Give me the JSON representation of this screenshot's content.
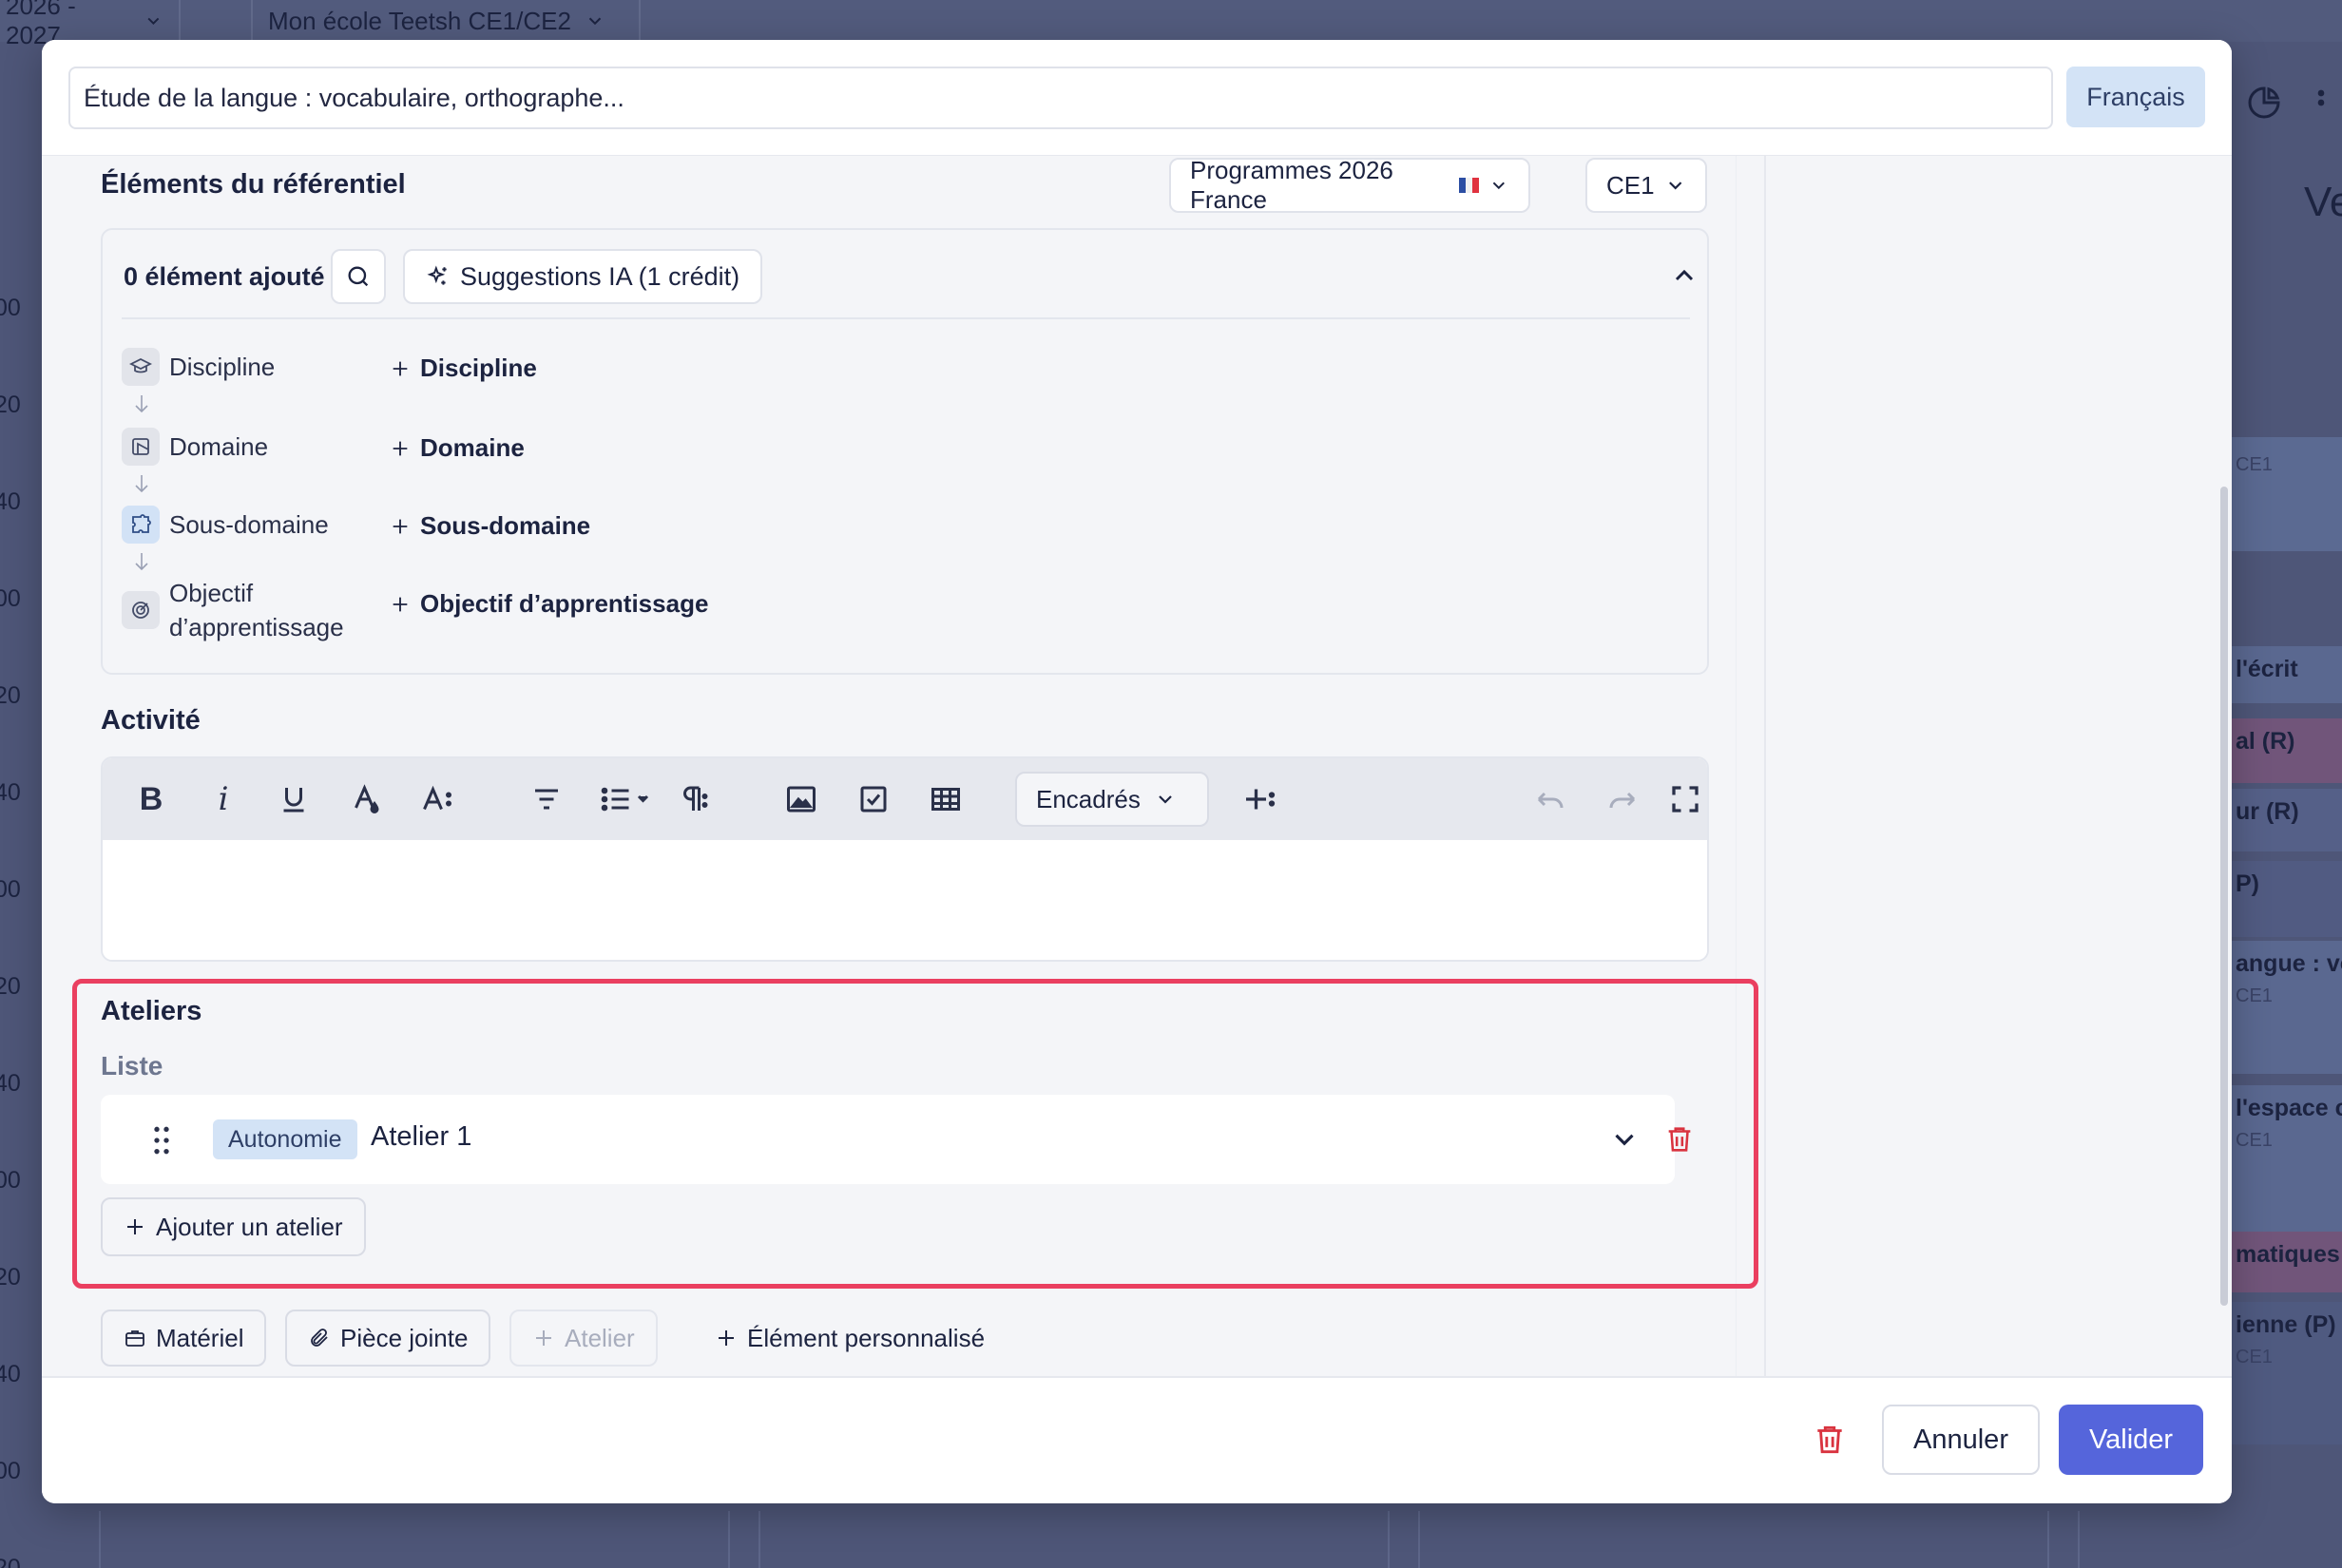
{
  "background": {
    "year_selector": "2026 - 2027",
    "school_selector": "Mon école Teetsh CE1/CE2",
    "hour_labels": [
      "00",
      "20",
      "40",
      "00",
      "20",
      "40",
      "00",
      "20",
      "40",
      "00",
      "20",
      "40",
      "00",
      "20"
    ],
    "heading_fragment": "Ve",
    "events": [
      {
        "title": "",
        "sub": "CE1"
      },
      {
        "title": "l'écrit",
        "sub": ""
      },
      {
        "title": "al (R)",
        "sub": ""
      },
      {
        "title": "ur (R)",
        "sub": ""
      },
      {
        "title": "P)",
        "sub": ""
      },
      {
        "title": "angue : vo",
        "sub": "CE1"
      },
      {
        "title": "l'espace c",
        "sub": "CE1"
      },
      {
        "title": "matiques",
        "sub": ""
      },
      {
        "title": "ienne (P)",
        "sub": "CE1"
      }
    ]
  },
  "header": {
    "title_value": "Étude de la langue : vocabulaire, orthographe...",
    "subject": "Français"
  },
  "referentiel": {
    "title": "Éléments du référentiel",
    "program": "Programmes 2026 France",
    "level": "CE1",
    "count_label": "0 élément ajouté",
    "ai_button": "Suggestions IA (1 crédit)",
    "levels": [
      {
        "icon": "graduation-cap-icon",
        "label": "Discipline",
        "add": "Discipline"
      },
      {
        "icon": "domain-icon",
        "label": "Domaine",
        "add": "Domaine"
      },
      {
        "icon": "puzzle-icon",
        "label": "Sous-domaine",
        "add": "Sous-domaine"
      },
      {
        "icon": "target-icon",
        "label": "Objectif d’apprentissage",
        "add": "Objectif d’apprentissage"
      }
    ]
  },
  "activity": {
    "title": "Activité",
    "toolbar": {
      "bold": "B",
      "italic": "i",
      "boxes_select": "Encadrés"
    }
  },
  "ateliers": {
    "title": "Ateliers",
    "list_label": "Liste",
    "items": [
      {
        "tag": "Autonomie",
        "name": "Atelier 1"
      }
    ],
    "add_button": "Ajouter un atelier"
  },
  "extras": {
    "material": "Matériel",
    "attachment": "Pièce jointe",
    "atelier": "Atelier",
    "custom": "Élément personnalisé"
  },
  "footer": {
    "cancel": "Annuler",
    "validate": "Valider"
  },
  "colors": {
    "accent": "#5565db",
    "highlight_border": "#ea3f60",
    "danger": "#d9333f",
    "tag_bg": "#d3e3f6"
  }
}
